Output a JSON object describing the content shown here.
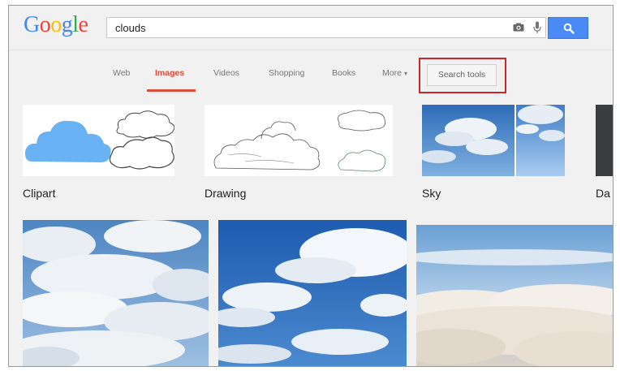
{
  "logo": {
    "letters": [
      "G",
      "o",
      "o",
      "g",
      "l",
      "e"
    ]
  },
  "search": {
    "query": "clouds"
  },
  "nav": {
    "tabs": [
      {
        "label": "Web"
      },
      {
        "label": "Images"
      },
      {
        "label": "Videos"
      },
      {
        "label": "Shopping"
      },
      {
        "label": "Books"
      },
      {
        "label": "More"
      }
    ],
    "search_tools_label": "Search tools"
  },
  "categories": [
    {
      "label": "Clipart"
    },
    {
      "label": "Drawing"
    },
    {
      "label": "Sky"
    },
    {
      "label": "Da"
    }
  ],
  "colors": {
    "accent_red": "#dd4b39",
    "search_blue": "#4a8af4",
    "highlight_red": "#c9252b"
  }
}
